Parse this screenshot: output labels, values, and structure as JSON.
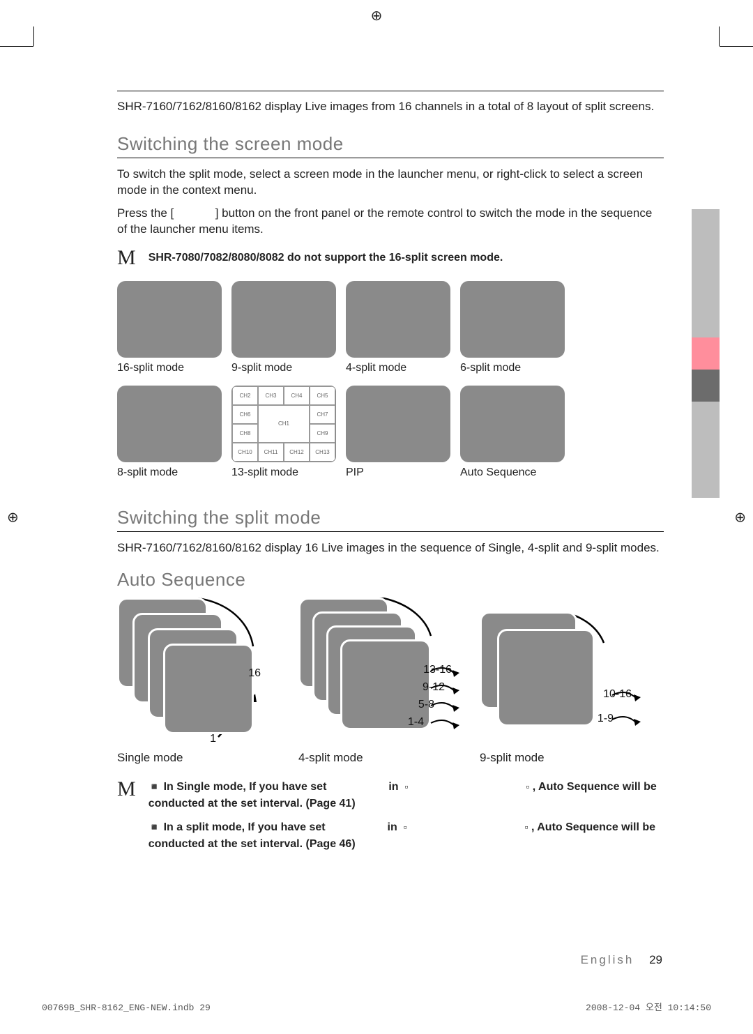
{
  "intro": "SHR-7160/7162/8160/8162 display Live images from 16 channels in a total of 8 layout of split screens.",
  "section1": {
    "title": "Switching the screen mode",
    "p1": "To switch the split mode, select a screen mode in the launcher menu, or right-click to select a screen mode in the context menu.",
    "p2_a": "Press the [",
    "p2_b": "] button on the front panel or the remote control to switch the mode in the sequence of the launcher menu items.",
    "note": "SHR-7080/7082/8080/8082 do not support the 16-split screen mode.",
    "modes": [
      "16-split mode",
      "9-split mode",
      "4-split mode",
      "6-split mode",
      "8-split mode",
      "13-split mode",
      "PIP",
      "Auto Sequence"
    ],
    "g13_cells": [
      "CH2",
      "CH3",
      "CH4",
      "CH5",
      "CH6",
      "CH7",
      "CH8",
      "CH1",
      "CH9",
      "CH10",
      "CH11",
      "CH12",
      "CH13"
    ]
  },
  "section2": {
    "title": "Switching the split mode",
    "p1": "SHR-7160/7162/8160/8162 display 16 Live images in the sequence of Single, 4-split and 9-split modes."
  },
  "section3": {
    "title": "Auto Sequence",
    "single": {
      "label": "Single mode",
      "n1": "1",
      "n16": "16"
    },
    "four": {
      "label": "4-split mode",
      "a": "1-4",
      "b": "5-8",
      "c": "9-12",
      "d": "13-16"
    },
    "nine": {
      "label": "9-split mode",
      "a": "1-9",
      "b": "10-16"
    },
    "notes": {
      "l1a": "In Single mode, If you have set",
      "l1b": "in",
      "l1c": ", Auto Sequence will be conducted at the set interval. (Page 41)",
      "l2a": "In a split mode, If you have set",
      "l2b": "in",
      "l2c": ", Auto Sequence will be conducted at the set interval. (Page 46)"
    }
  },
  "footer": {
    "lang": "English",
    "page": "29"
  },
  "print": {
    "left": "00769B_SHR-8162_ENG-NEW.indb   29",
    "right": "2008-12-04   오전 10:14:50"
  },
  "thumb_colors": [
    "#bdbdbd",
    "#bdbdbd",
    "#bdbdbd",
    "#bdbdbd",
    "#ff8e9c",
    "#6c6c6c",
    "#bdbdbd",
    "#bdbdbd",
    "#bdbdbd"
  ]
}
